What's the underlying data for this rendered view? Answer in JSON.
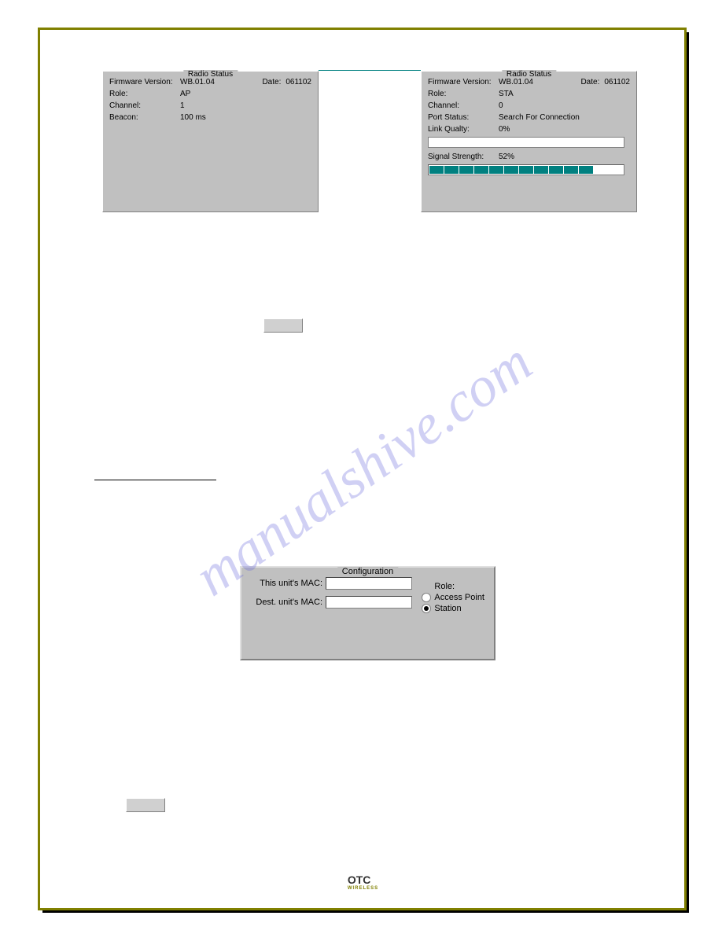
{
  "watermark": "manualshive.com",
  "panels": {
    "left": {
      "title": "Radio Status",
      "firmware_label": "Firmware Version:",
      "firmware_value": "WB.01.04",
      "date_label": "Date:",
      "date_value": "061102",
      "role_label": "Role:",
      "role_value": "AP",
      "channel_label": "Channel:",
      "channel_value": "1",
      "beacon_label": "Beacon:",
      "beacon_value": "100 ms"
    },
    "right": {
      "title": "Radio Status",
      "firmware_label": "Firmware Version:",
      "firmware_value": "WB.01.04",
      "date_label": "Date:",
      "date_value": "061102",
      "role_label": "Role:",
      "role_value": "STA",
      "channel_label": "Channel:",
      "channel_value": "0",
      "port_label": "Port Status:",
      "port_value": "Search For Connection",
      "link_label": "Link Qualty:",
      "link_value": "0%",
      "signal_label": "Signal Strength:",
      "signal_value": "52%",
      "signal_segments": 11
    }
  },
  "config": {
    "title": "Configuration",
    "mac1_label": "This unit's MAC:",
    "mac2_label": "Dest. unit's MAC:",
    "role_title": "Role:",
    "role_ap": "Access Point",
    "role_sta": "Station",
    "selected": "station"
  },
  "footer": {
    "brand": "OTC",
    "sub": "WIRELESS"
  }
}
